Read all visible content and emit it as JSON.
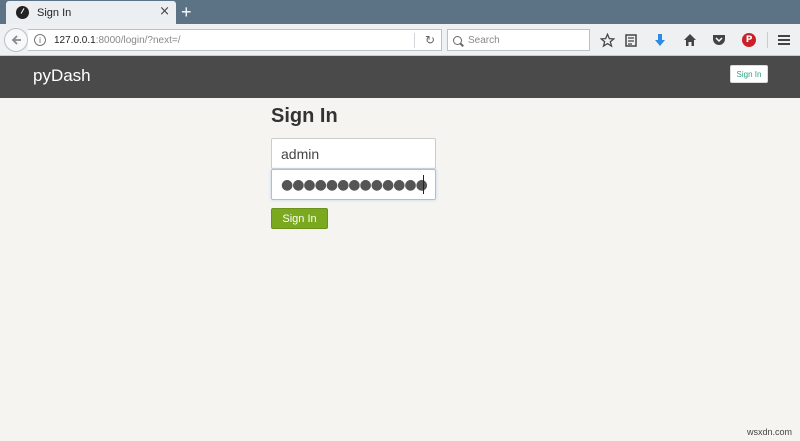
{
  "browser": {
    "tab": {
      "title": "Sign In",
      "close_glyph": "×"
    },
    "new_tab_glyph": "+",
    "url": {
      "host": "127.0.0.1",
      "path": ":8000/login/?next=/"
    },
    "search": {
      "placeholder": "Search"
    },
    "toolbar_icons": [
      "star-icon",
      "reading-list-icon",
      "download-icon",
      "home-icon",
      "pocket-icon",
      "pinterest-icon",
      "menu-icon"
    ],
    "pinterest_letter": "P"
  },
  "app": {
    "brand": "pyDash",
    "header_signin": "Sign In"
  },
  "form": {
    "title": "Sign In",
    "username_value": "admin",
    "password_mask": "●●●●●●●●●●●●●",
    "submit_label": "Sign In"
  },
  "watermark": "wsxdn.com",
  "colors": {
    "tabbar": "#5c7285",
    "header": "#4a4a4a",
    "page_bg": "#f6f4f0",
    "submit": "#7aa81e",
    "download_blue": "#2c8ae8",
    "pinterest_red": "#cb2027"
  }
}
